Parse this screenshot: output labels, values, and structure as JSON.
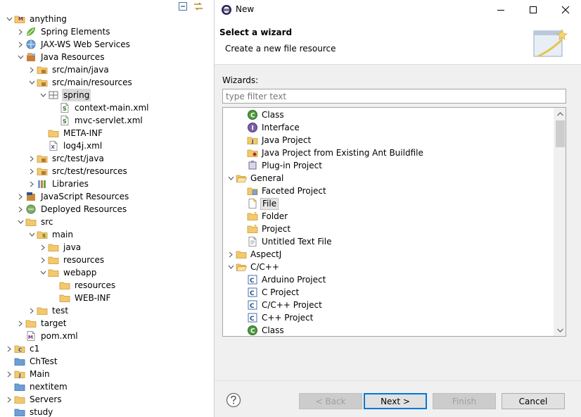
{
  "explorer": {
    "items": [
      {
        "label": "anything",
        "depth": 0,
        "expanded": true,
        "icon": "maven-project-icon"
      },
      {
        "label": "Spring Elements",
        "depth": 1,
        "expanded": false,
        "icon": "spring-leaf-icon"
      },
      {
        "label": "JAX-WS Web Services",
        "depth": 1,
        "expanded": false,
        "icon": "web-services-icon"
      },
      {
        "label": "Java Resources",
        "depth": 1,
        "expanded": true,
        "icon": "java-resources-icon"
      },
      {
        "label": "src/main/java",
        "depth": 2,
        "expanded": false,
        "icon": "source-folder-icon"
      },
      {
        "label": "src/main/resources",
        "depth": 2,
        "expanded": true,
        "icon": "source-folder-icon"
      },
      {
        "label": "spring",
        "depth": 3,
        "expanded": true,
        "icon": "package-icon",
        "selected": true
      },
      {
        "label": "context-main.xml",
        "depth": 4,
        "icon": "spring-xml-icon"
      },
      {
        "label": "mvc-servlet.xml",
        "depth": 4,
        "icon": "spring-xml-icon"
      },
      {
        "label": "META-INF",
        "depth": 3,
        "icon": "folder-icon"
      },
      {
        "label": "log4j.xml",
        "depth": 3,
        "icon": "xml-file-icon"
      },
      {
        "label": "src/test/java",
        "depth": 2,
        "expanded": false,
        "icon": "source-folder-icon"
      },
      {
        "label": "src/test/resources",
        "depth": 2,
        "expanded": false,
        "icon": "source-folder-icon"
      },
      {
        "label": "Libraries",
        "depth": 2,
        "expanded": false,
        "icon": "libraries-icon"
      },
      {
        "label": "JavaScript Resources",
        "depth": 1,
        "expanded": false,
        "icon": "javascript-resources-icon"
      },
      {
        "label": "Deployed Resources",
        "depth": 1,
        "expanded": false,
        "icon": "deployed-resources-icon"
      },
      {
        "label": "src",
        "depth": 1,
        "expanded": true,
        "icon": "folder-icon"
      },
      {
        "label": "main",
        "depth": 2,
        "expanded": true,
        "icon": "spring-folder-icon"
      },
      {
        "label": "java",
        "depth": 3,
        "expanded": false,
        "icon": "folder-icon"
      },
      {
        "label": "resources",
        "depth": 3,
        "expanded": false,
        "icon": "folder-icon"
      },
      {
        "label": "webapp",
        "depth": 3,
        "expanded": true,
        "icon": "folder-icon"
      },
      {
        "label": "resources",
        "depth": 4,
        "icon": "folder-icon"
      },
      {
        "label": "WEB-INF",
        "depth": 4,
        "icon": "folder-icon"
      },
      {
        "label": "test",
        "depth": 2,
        "expanded": false,
        "icon": "folder-icon"
      },
      {
        "label": "target",
        "depth": 1,
        "expanded": false,
        "icon": "folder-icon"
      },
      {
        "label": "pom.xml",
        "depth": 1,
        "icon": "maven-pom-icon"
      },
      {
        "label": "c1",
        "depth": 0,
        "expanded": false,
        "icon": "c-project-icon"
      },
      {
        "label": "ChTest",
        "depth": 0,
        "icon": "closed-project-icon"
      },
      {
        "label": "Main",
        "depth": 0,
        "expanded": false,
        "icon": "java-project-icon"
      },
      {
        "label": "nextitem",
        "depth": 0,
        "icon": "closed-project-icon"
      },
      {
        "label": "Servers",
        "depth": 0,
        "expanded": false,
        "icon": "servers-folder-icon"
      },
      {
        "label": "study",
        "depth": 0,
        "icon": "closed-project-icon"
      }
    ]
  },
  "dialog": {
    "title": "New",
    "heading": "Select a wizard",
    "subheading": "Create a new file resource",
    "wizards_label": "Wizards:",
    "filter_placeholder": "type filter text",
    "wizards": [
      {
        "label": "Class",
        "depth": 1,
        "icon": "java-class-icon"
      },
      {
        "label": "Interface",
        "depth": 1,
        "icon": "java-interface-icon"
      },
      {
        "label": "Java Project",
        "depth": 1,
        "icon": "java-project-icon"
      },
      {
        "label": "Java Project from Existing Ant Buildfile",
        "depth": 1,
        "icon": "ant-project-icon"
      },
      {
        "label": "Plug-in Project",
        "depth": 1,
        "icon": "plugin-project-icon"
      },
      {
        "label": "General",
        "depth": 0,
        "expanded": true,
        "icon": "folder-open-icon"
      },
      {
        "label": "Faceted Project",
        "depth": 1,
        "icon": "faceted-project-icon"
      },
      {
        "label": "File",
        "depth": 1,
        "icon": "new-file-icon",
        "selected": true
      },
      {
        "label": "Folder",
        "depth": 1,
        "icon": "new-folder-icon"
      },
      {
        "label": "Project",
        "depth": 1,
        "icon": "new-project-icon"
      },
      {
        "label": "Untitled Text File",
        "depth": 1,
        "icon": "text-file-icon"
      },
      {
        "label": "AspectJ",
        "depth": 0,
        "expanded": false,
        "icon": "folder-icon"
      },
      {
        "label": "C/C++",
        "depth": 0,
        "expanded": true,
        "icon": "folder-open-icon"
      },
      {
        "label": "Arduino Project",
        "depth": 1,
        "icon": "cpp-project-icon"
      },
      {
        "label": "C Project",
        "depth": 1,
        "icon": "cpp-project-icon"
      },
      {
        "label": "C/C++ Project",
        "depth": 1,
        "icon": "cpp-project-icon"
      },
      {
        "label": "C++ Project",
        "depth": 1,
        "icon": "cpp-project-icon"
      },
      {
        "label": "Class",
        "depth": 1,
        "icon": "cpp-class-icon"
      }
    ],
    "buttons": {
      "back": "< Back",
      "next": "Next >",
      "finish": "Finish",
      "cancel": "Cancel"
    }
  }
}
